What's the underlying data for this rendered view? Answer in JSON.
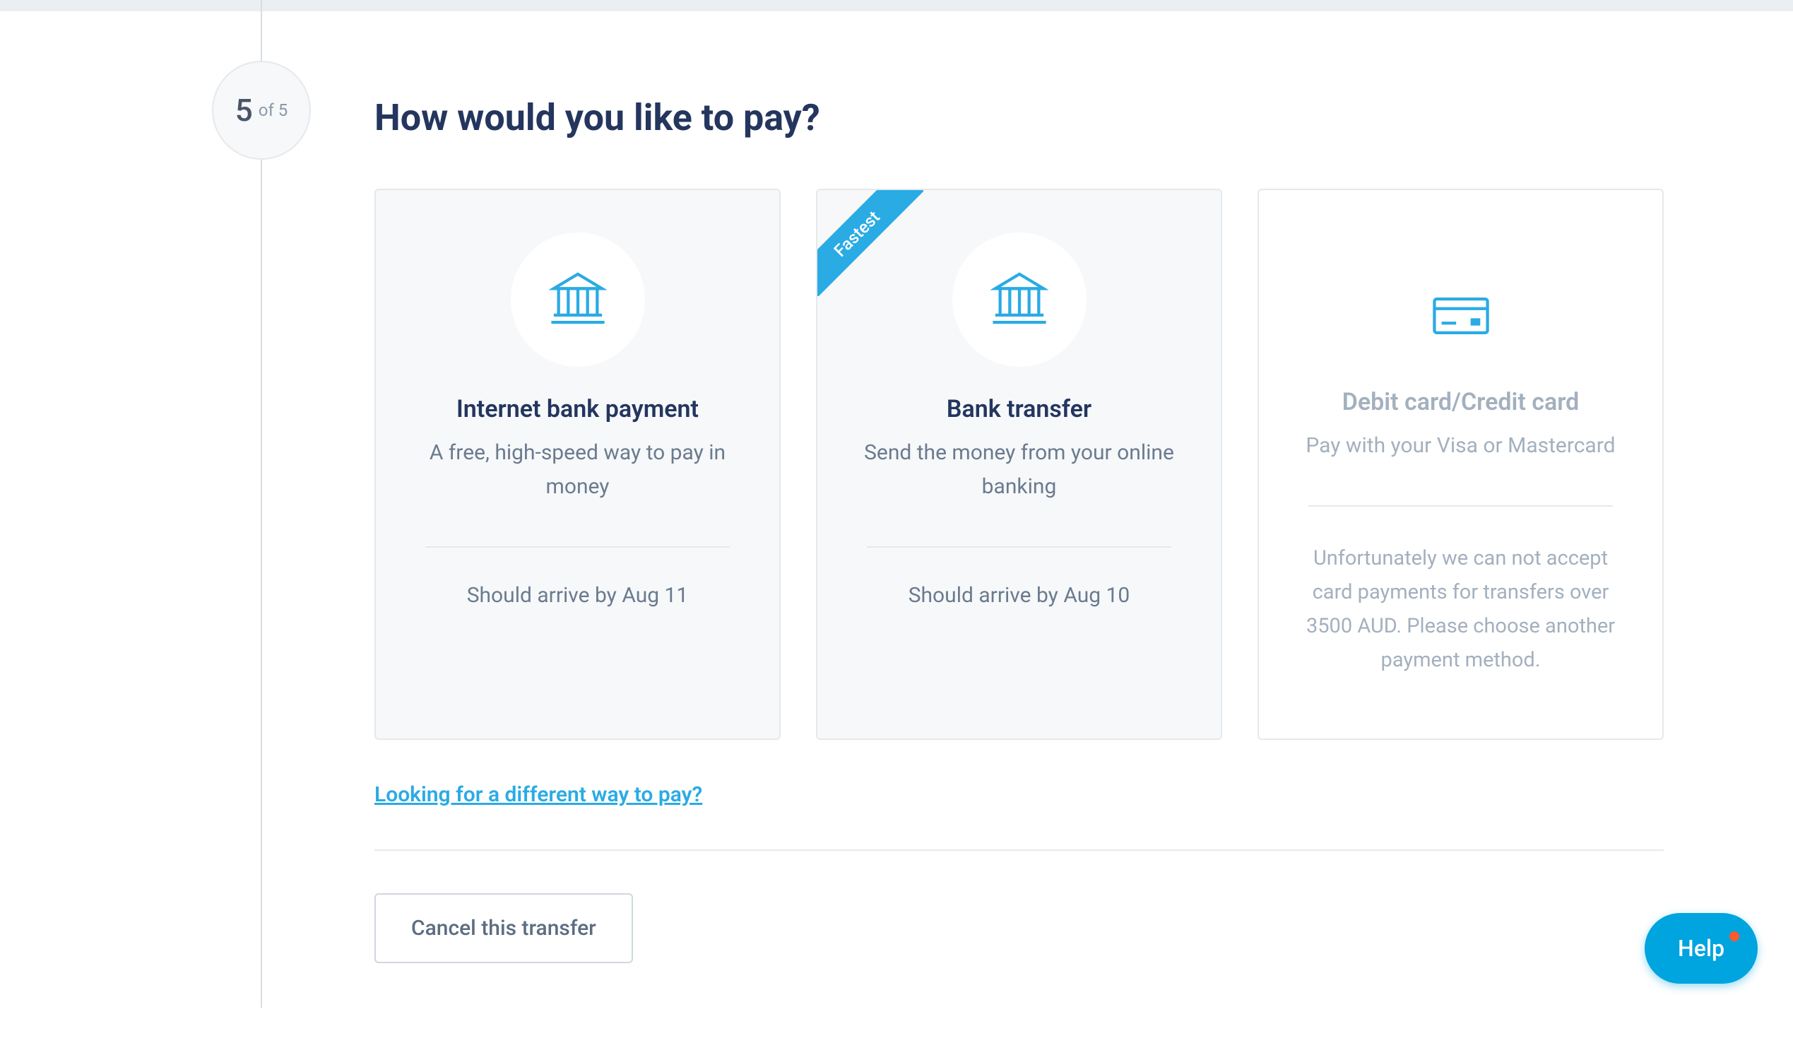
{
  "step": {
    "current": "5",
    "of_text": "of 5"
  },
  "page_title": "How would you like to pay?",
  "cards": [
    {
      "title": "Internet bank payment",
      "description": "A free, high-speed way to pay in money",
      "arrival": "Should arrive by Aug 11",
      "ribbon": null
    },
    {
      "title": "Bank transfer",
      "description": "Send the money from your online banking",
      "arrival": "Should arrive by Aug 10",
      "ribbon": "Fastest"
    },
    {
      "title": "Debit card/Credit card",
      "description": "Pay with your Visa or Mastercard",
      "note": "Unfortunately we can not accept card payments for transfers over 3500 AUD. Please choose another payment method."
    }
  ],
  "different_way_link": "Looking for a different way to pay?",
  "cancel_button": "Cancel this transfer",
  "help_button": "Help",
  "colors": {
    "accent": "#2aabe4",
    "dark_text": "#24365e",
    "muted_text": "#6b7b8e"
  }
}
